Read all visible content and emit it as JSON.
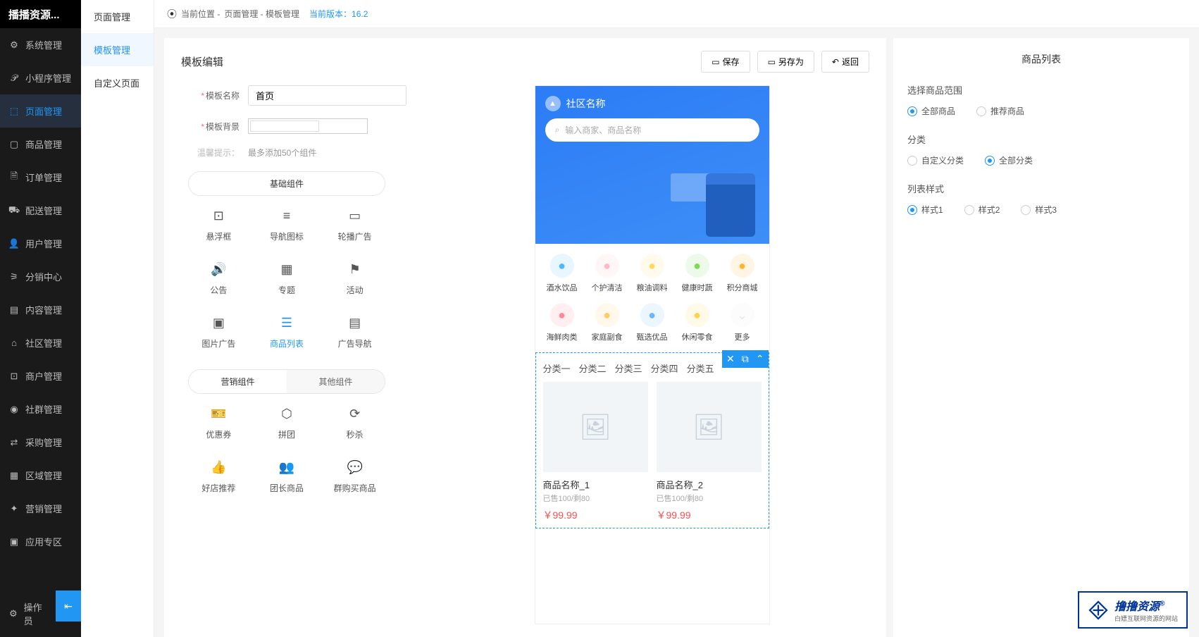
{
  "logo": "播播资源...",
  "breadcrumb": {
    "prefix": "当前位置 - ",
    "path": "页面管理 - 模板管理",
    "versionLabel": "当前版本：16.2"
  },
  "sidebar": [
    {
      "label": "系统管理",
      "icon": "gear"
    },
    {
      "label": "小程序管理",
      "icon": "app"
    },
    {
      "label": "页面管理",
      "icon": "page",
      "active": true
    },
    {
      "label": "商品管理",
      "icon": "box"
    },
    {
      "label": "订单管理",
      "icon": "order"
    },
    {
      "label": "配送管理",
      "icon": "delivery"
    },
    {
      "label": "用户管理",
      "icon": "user"
    },
    {
      "label": "分销中心",
      "icon": "share"
    },
    {
      "label": "内容管理",
      "icon": "content"
    },
    {
      "label": "社区管理",
      "icon": "community"
    },
    {
      "label": "商户管理",
      "icon": "merchant"
    },
    {
      "label": "社群管理",
      "icon": "group"
    },
    {
      "label": "采购管理",
      "icon": "purchase"
    },
    {
      "label": "区域管理",
      "icon": "region"
    },
    {
      "label": "营销管理",
      "icon": "marketing"
    },
    {
      "label": "应用专区",
      "icon": "apps"
    }
  ],
  "sidebarBottom": {
    "label": "操作员",
    "icon": "gear"
  },
  "subSidebar": {
    "header": "页面管理",
    "items": [
      {
        "label": "模板管理",
        "active": true
      },
      {
        "label": "自定义页面"
      }
    ]
  },
  "editor": {
    "title": "模板编辑",
    "actions": {
      "save": "保存",
      "saveAs": "另存为",
      "back": "返回"
    },
    "form": {
      "nameLabel": "模板名称",
      "nameValue": "首页",
      "bgLabel": "模板背景",
      "hintLabel": "温馨提示：",
      "hintValue": "最多添加50个组件"
    },
    "tabs": {
      "basic": "基础组件",
      "marketing": "营销组件",
      "other": "其他组件"
    },
    "basicComponents": [
      {
        "label": "悬浮框",
        "glyph": "⊡"
      },
      {
        "label": "导航图标",
        "glyph": "≡"
      },
      {
        "label": "轮播广告",
        "glyph": "▭"
      },
      {
        "label": "公告",
        "glyph": "🔊"
      },
      {
        "label": "专题",
        "glyph": "▦"
      },
      {
        "label": "活动",
        "glyph": "⚑"
      },
      {
        "label": "图片广告",
        "glyph": "▣"
      },
      {
        "label": "商品列表",
        "glyph": "☰",
        "active": true
      },
      {
        "label": "广告导航",
        "glyph": "▤"
      }
    ],
    "marketingComponents": [
      {
        "label": "优惠券",
        "glyph": "🎫"
      },
      {
        "label": "拼团",
        "glyph": "⬡"
      },
      {
        "label": "秒杀",
        "glyph": "⟳"
      },
      {
        "label": "好店推荐",
        "glyph": "👍"
      },
      {
        "label": "团长商品",
        "glyph": "👥"
      },
      {
        "label": "群购买商品",
        "glyph": "💬"
      }
    ]
  },
  "preview": {
    "communityName": "社区名称",
    "searchPlaceholder": "输入商家、商品名称",
    "navItems": [
      {
        "label": "酒水饮品",
        "color": "#4db8ff"
      },
      {
        "label": "个护清洁",
        "color": "#ffb8c8"
      },
      {
        "label": "粮油调料",
        "color": "#ffd966"
      },
      {
        "label": "健康时蔬",
        "color": "#7ed957"
      },
      {
        "label": "积分商城",
        "color": "#ffb733"
      },
      {
        "label": "海鲜肉类",
        "color": "#ff8899"
      },
      {
        "label": "家庭副食",
        "color": "#ffcc66"
      },
      {
        "label": "甄选优品",
        "color": "#6bb8ff"
      },
      {
        "label": "休闲零食",
        "color": "#ffd24d"
      },
      {
        "label": "更多",
        "color": "#e8e8e8",
        "more": true
      }
    ],
    "catTabs": [
      "分类一",
      "分类二",
      "分类三",
      "分类四",
      "分类五"
    ],
    "products": [
      {
        "name": "商品名称_1",
        "sub": "已售100/剩80",
        "price": "￥99.99"
      },
      {
        "name": "商品名称_2",
        "sub": "已售100/剩80",
        "price": "￥99.99"
      }
    ]
  },
  "settings": {
    "title": "商品列表",
    "groups": [
      {
        "label": "选择商品范围",
        "options": [
          {
            "label": "全部商品",
            "checked": true
          },
          {
            "label": "推荐商品"
          }
        ]
      },
      {
        "label": "分类",
        "options": [
          {
            "label": "自定义分类"
          },
          {
            "label": "全部分类",
            "checked": true
          }
        ]
      },
      {
        "label": "列表样式",
        "options": [
          {
            "label": "样式1",
            "checked": true
          },
          {
            "label": "样式2"
          },
          {
            "label": "样式3"
          }
        ]
      }
    ]
  },
  "watermark": {
    "brand": "撸撸资源",
    "sub": "白嫖互联网资源的网站",
    "reg": "®"
  }
}
